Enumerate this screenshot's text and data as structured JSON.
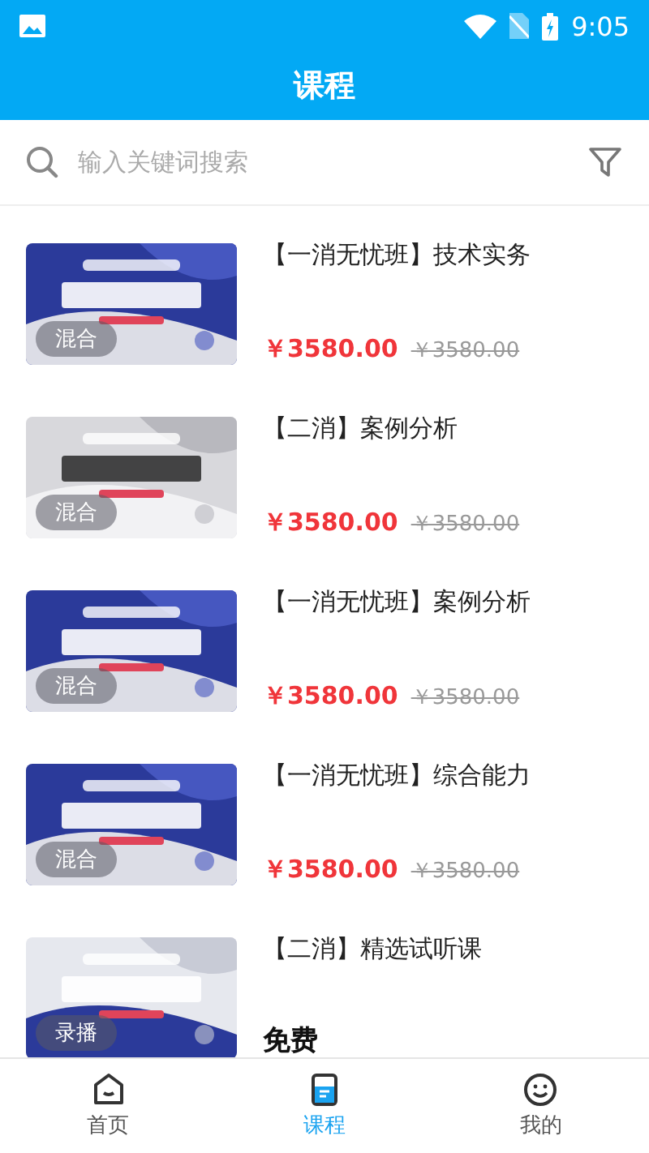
{
  "status_bar": {
    "time": "9:05"
  },
  "header": {
    "title": "课程"
  },
  "search": {
    "placeholder": "输入关键词搜索"
  },
  "courses": [
    {
      "title": "【一消无忧班】技术实务",
      "badge": "混合",
      "price": "￥3580.00",
      "original_price": "￥3580.00",
      "free": false
    },
    {
      "title": "【二消】案例分析",
      "badge": "混合",
      "price": "￥3580.00",
      "original_price": "￥3580.00",
      "free": false
    },
    {
      "title": "【一消无忧班】案例分析",
      "badge": "混合",
      "price": "￥3580.00",
      "original_price": "￥3580.00",
      "free": false
    },
    {
      "title": "【一消无忧班】综合能力",
      "badge": "混合",
      "price": "￥3580.00",
      "original_price": "￥3580.00",
      "free": false
    },
    {
      "title": "【二消】精选试听课",
      "badge": "录播",
      "price": "免费",
      "free": true
    }
  ],
  "tabs": [
    {
      "label": "首页",
      "selected": false,
      "kind": "home"
    },
    {
      "label": "课程",
      "selected": true,
      "kind": "course"
    },
    {
      "label": "我的",
      "selected": false,
      "kind": "me"
    }
  ]
}
